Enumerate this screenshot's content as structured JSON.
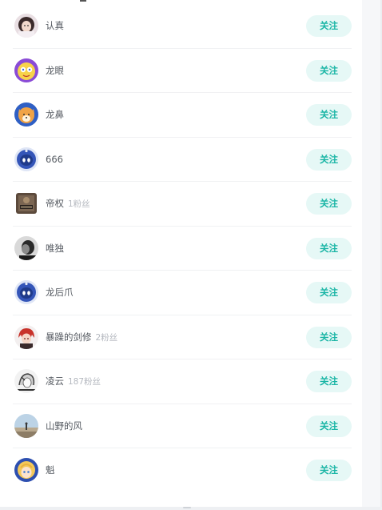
{
  "follow_label": "关注",
  "users": [
    {
      "name": "认真",
      "fans": "",
      "avatar": "avatar-girl-icon"
    },
    {
      "name": "龙眼",
      "fans": "",
      "avatar": "avatar-yellow-cartoon-icon"
    },
    {
      "name": "龙鼻",
      "fans": "",
      "avatar": "avatar-fox-icon"
    },
    {
      "name": "666",
      "fans": "",
      "avatar": "avatar-robot-icon"
    },
    {
      "name": "帝权",
      "fans": "1粉丝",
      "avatar": "avatar-book-icon"
    },
    {
      "name": "唯独",
      "fans": "",
      "avatar": "avatar-mono-portrait-icon"
    },
    {
      "name": "龙后爪",
      "fans": "",
      "avatar": "avatar-robot-icon"
    },
    {
      "name": "暴躁的剑修",
      "fans": "2粉丝",
      "avatar": "avatar-redhair-icon"
    },
    {
      "name": "凌云",
      "fans": "187粉丝",
      "avatar": "avatar-sketch-icon"
    },
    {
      "name": "山野的风",
      "fans": "",
      "avatar": "avatar-landscape-icon"
    },
    {
      "name": "魁",
      "fans": "",
      "avatar": "avatar-blonde-icon"
    }
  ],
  "colors": {
    "accent": "#19b5a5",
    "button_bg": "#e6f8f6",
    "name": "#555a61",
    "fans": "#b4b8bf"
  }
}
